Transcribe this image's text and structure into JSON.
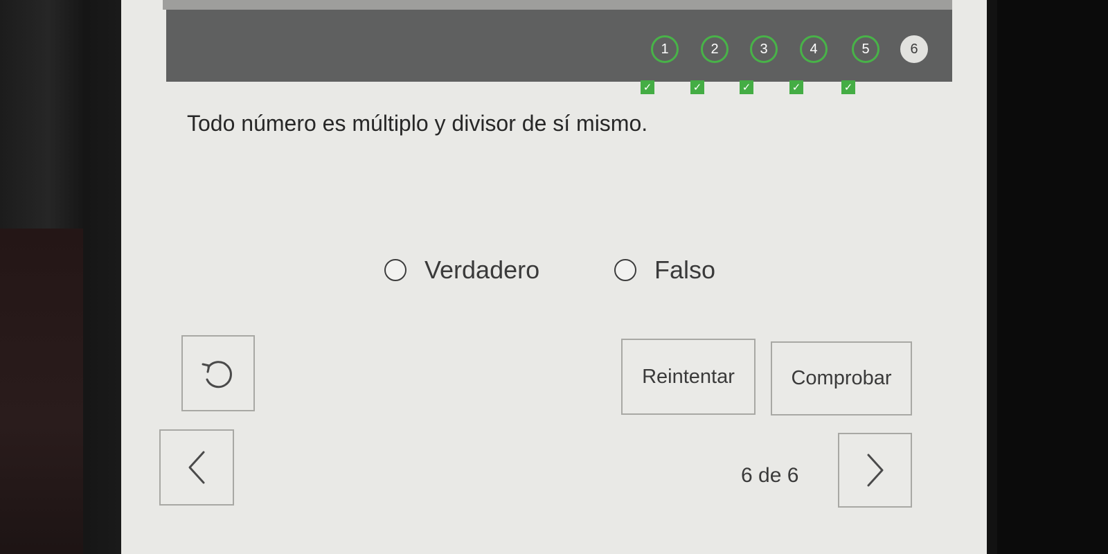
{
  "progress": {
    "steps": [
      {
        "label": "1",
        "completed": true
      },
      {
        "label": "2",
        "completed": true
      },
      {
        "label": "3",
        "completed": true
      },
      {
        "label": "4",
        "completed": true
      },
      {
        "label": "5",
        "completed": true
      },
      {
        "label": "6",
        "completed": false,
        "current": true
      }
    ],
    "check_icon": "checkbox-checked-icon",
    "colors": {
      "done_ring": "#48b348",
      "check_fill": "#44ad44",
      "bar": "#5f6060"
    }
  },
  "question": {
    "text": "Todo número es múltiplo y divisor de sí mismo."
  },
  "options": [
    {
      "label": "Verdadero",
      "selected": false
    },
    {
      "label": "Falso",
      "selected": false
    }
  ],
  "buttons": {
    "reset_icon": "reset-arrow-icon",
    "retry_label": "Reintentar",
    "check_label": "Comprobar"
  },
  "navigation": {
    "prev_icon": "chevron-left-icon",
    "next_icon": "chevron-right-icon",
    "page_label": "6 de 6"
  }
}
